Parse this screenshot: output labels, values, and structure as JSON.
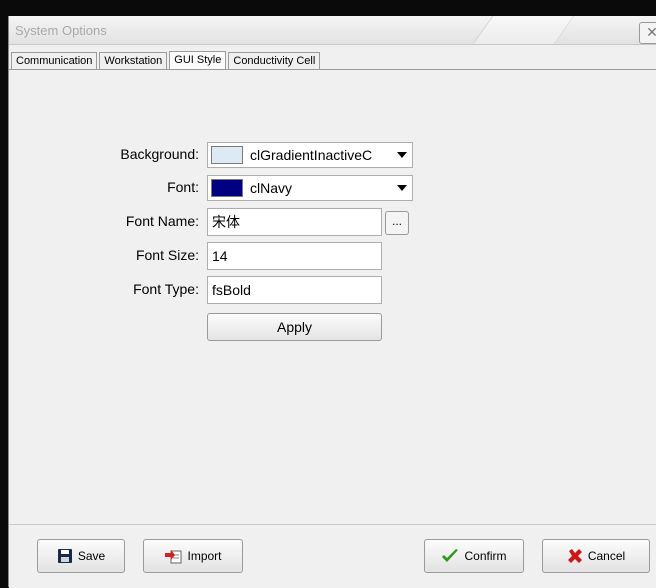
{
  "window": {
    "title": "System Options",
    "close_icon": "close-icon"
  },
  "tabs": [
    {
      "label": "Communication"
    },
    {
      "label": "Workstation"
    },
    {
      "label": "GUI Style",
      "active": true
    },
    {
      "label": "Conductivity Cell"
    }
  ],
  "form": {
    "background": {
      "label": "Background:",
      "value": "clGradientInactiveC",
      "swatch_color": "#dde9f5"
    },
    "font": {
      "label": "Font:",
      "value": "clNavy",
      "swatch_color": "#000080"
    },
    "font_name": {
      "label": "Font Name:",
      "value": "宋体",
      "browse_label": "..."
    },
    "font_size": {
      "label": "Font Size:",
      "value": "14"
    },
    "font_type": {
      "label": "Font Type:",
      "value": "fsBold"
    },
    "apply_label": "Apply"
  },
  "buttons": {
    "save": {
      "label": "Save",
      "icon": "floppy-disk-icon"
    },
    "import": {
      "label": "Import",
      "icon": "import-icon"
    },
    "confirm": {
      "label": "Confirm",
      "icon": "checkmark-icon"
    },
    "cancel": {
      "label": "Cancel",
      "icon": "red-x-icon"
    }
  }
}
